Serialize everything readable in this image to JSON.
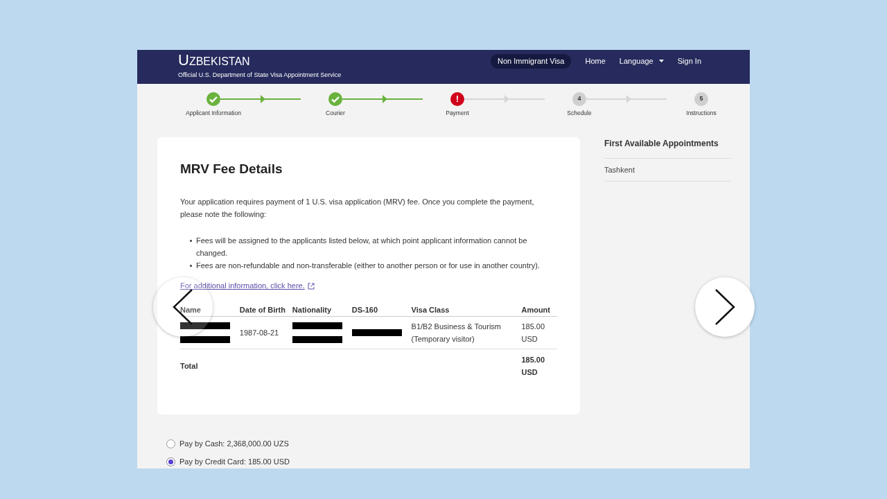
{
  "header": {
    "title_big": "U",
    "title_rest": "ZBEKISTAN",
    "subtitle": "Official U.S. Department of State Visa Appointment Service",
    "nav": [
      {
        "label": "Non Immigrant Visa",
        "selected": true,
        "kind": "pill"
      },
      {
        "label": "Home",
        "selected": false,
        "kind": "link"
      },
      {
        "label": "Language",
        "selected": false,
        "kind": "dropdown"
      },
      {
        "label": "Sign In",
        "selected": false,
        "kind": "link"
      }
    ]
  },
  "steps": [
    {
      "label": "Applicant Information",
      "kind": "done"
    },
    {
      "label": "Courier",
      "kind": "done"
    },
    {
      "label": "Payment",
      "kind": "error",
      "symbol": "!"
    },
    {
      "label": "Schedule",
      "kind": "pending",
      "symbol": "4"
    },
    {
      "label": "Instructions",
      "kind": "pending",
      "symbol": "5"
    }
  ],
  "card": {
    "title": "MRV Fee Details",
    "intro": "Your application requires payment of 1 U.S. visa application (MRV) fee. Once you complete the payment, please note the following:",
    "bullets": [
      "Fees will be assigned to the applicants listed below, at which point applicant information cannot be changed.",
      "Fees are non-refundable and non-transferable (either to another person or for use in another country)."
    ],
    "link": "For additional information, click here.",
    "table": {
      "columns": [
        "Name",
        "Date of Birth",
        "Nationality",
        "DS-160",
        "Visa Class",
        "Amount"
      ],
      "rows": [
        {
          "cells": [
            {
              "kind": "redacted_double"
            },
            {
              "kind": "text",
              "text": "1987-08-21"
            },
            {
              "kind": "redacted_double"
            },
            {
              "kind": "redacted"
            },
            {
              "kind": "text",
              "text": "B1/B2 Business & Tourism (Temporary visitor)"
            },
            {
              "kind": "text",
              "text": "185.00 USD"
            }
          ]
        }
      ],
      "total_label": "Total",
      "total_value": "185.00 USD"
    }
  },
  "sidebar": {
    "title": "First Available Appointments",
    "items": [
      "Tashkent"
    ]
  },
  "payment_options": [
    {
      "label": "Pay by Cash: 2,368,000.00 UZS",
      "selected": false
    },
    {
      "label": "Pay by Credit Card: 185.00 USD",
      "selected": true
    }
  ]
}
